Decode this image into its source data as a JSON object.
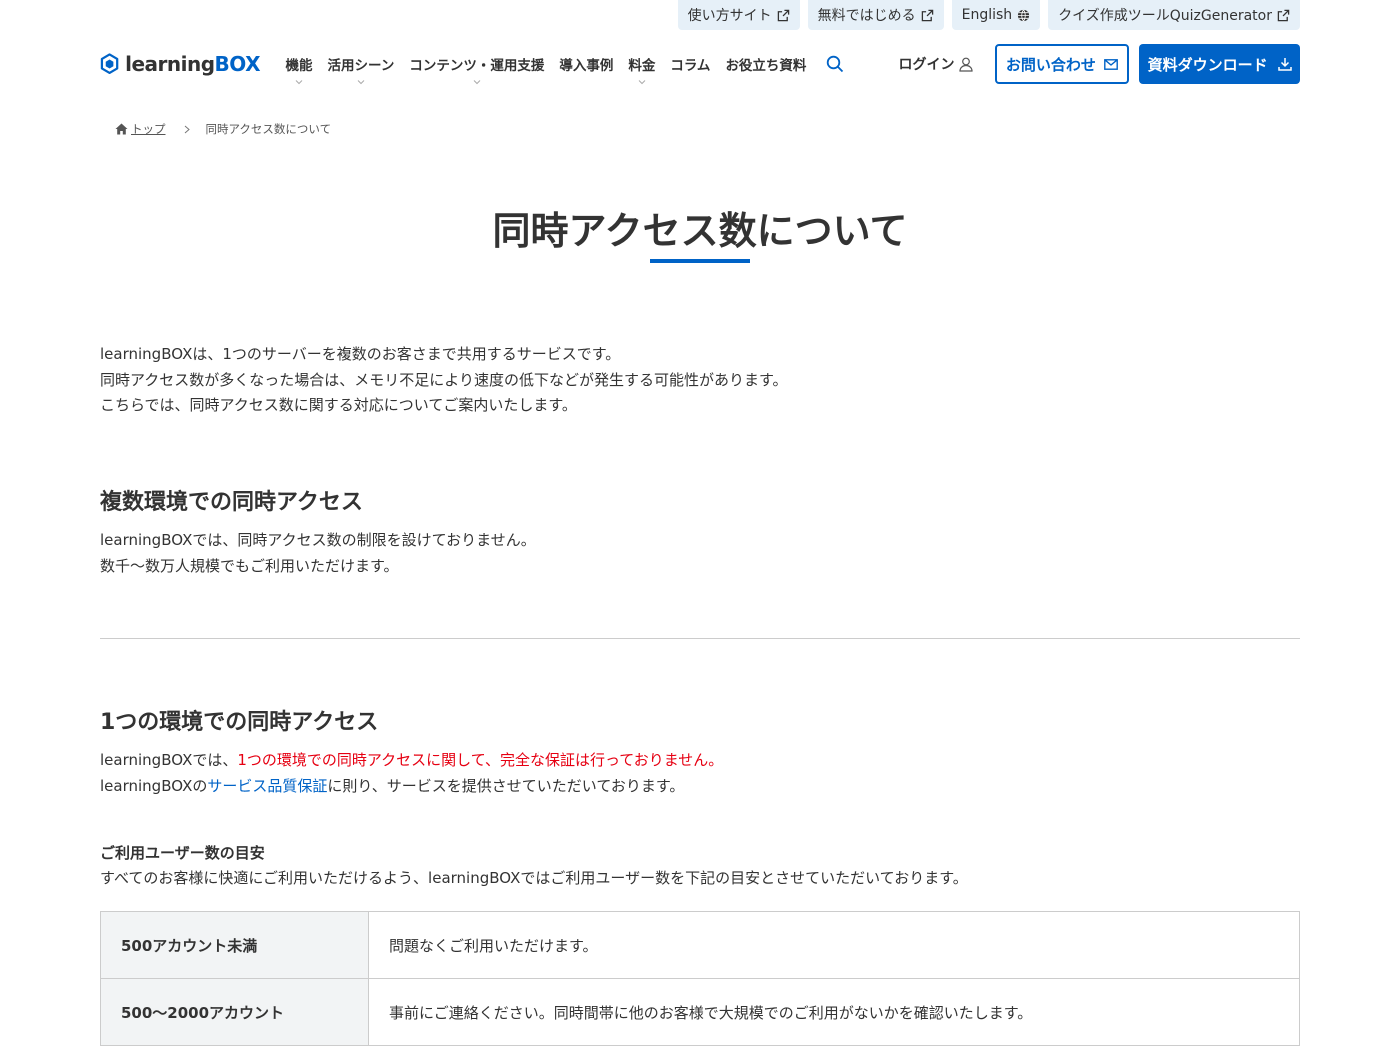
{
  "utility_links": [
    {
      "label": "使い方サイト",
      "icon": "external-link-icon"
    },
    {
      "label": "無料ではじめる",
      "icon": "external-link-icon"
    },
    {
      "label": "English",
      "icon": "globe-icon"
    },
    {
      "label": "クイズ作成ツールQuizGenerator",
      "icon": "external-link-icon"
    }
  ],
  "header": {
    "logo_text": "learning",
    "logo_text_accent": "BOX",
    "nav": [
      {
        "label": "機能",
        "has_dropdown": true
      },
      {
        "label": "活用シーン",
        "has_dropdown": true
      },
      {
        "label": "コンテンツ・運用支援",
        "has_dropdown": true
      },
      {
        "label": "導入事例",
        "has_dropdown": false
      },
      {
        "label": "料金",
        "has_dropdown": true
      },
      {
        "label": "コラム",
        "has_dropdown": false
      },
      {
        "label": "お役立ち資料",
        "has_dropdown": false
      }
    ],
    "login_label": "ログイン",
    "contact_label": "お問い合わせ",
    "download_label": "資料ダウンロード"
  },
  "breadcrumb": {
    "home": "トップ",
    "current": "同時アクセス数について"
  },
  "page": {
    "title": "同時アクセス数について",
    "intro": [
      "learningBOXは、1つのサーバーを複数のお客さまで共用するサービスです。",
      "同時アクセス数が多くなった場合は、メモリ不足により速度の低下などが発生する可能性があります。",
      "こちらでは、同時アクセス数に関する対応についてご案内いたします。"
    ],
    "section1": {
      "heading": "複数環境での同時アクセス",
      "lines": [
        "learningBOXでは、同時アクセス数の制限を設けておりません。",
        "数千〜数万人規模でもご利用いただけます。"
      ]
    },
    "section2": {
      "heading": "1つの環境での同時アクセス",
      "line1_prefix": "learningBOXでは、",
      "line1_emphasis": "1つの環境での同時アクセスに関して、完全な保証は行っておりません。",
      "line2_prefix": "learningBOXの",
      "line2_link": "サービス品質保証",
      "line2_suffix": "に則り、サービスを提供させていただいております。"
    },
    "guide": {
      "heading": "ご利用ユーザー数の目安",
      "text": "すべてのお客様に快適にご利用いただけるよう、learningBOXではご利用ユーザー数を下記の目安とさせていただいております。",
      "rows": [
        {
          "range": "500アカウント未満",
          "note": "問題なくご利用いただけます。"
        },
        {
          "range": "500〜2000アカウント",
          "note": "事前にご連絡ください。同時間帯に他のお客様で大規模でのご利用がないかを確認いたします。"
        }
      ]
    }
  },
  "colors": {
    "brand": "#0063c7",
    "emphasis": "#e60012",
    "utility_bg": "#e6f0f8",
    "table_header_bg": "#f2f4f5"
  }
}
